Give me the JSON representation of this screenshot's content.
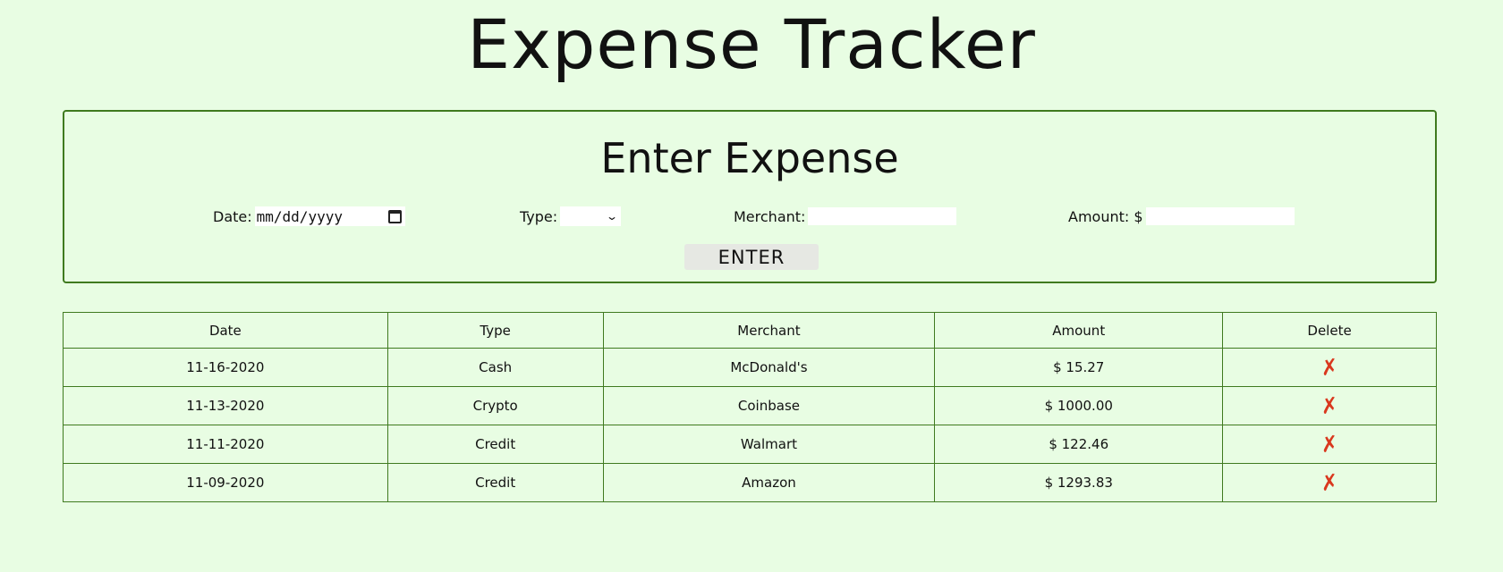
{
  "page": {
    "title": "Expense Tracker"
  },
  "form": {
    "title": "Enter Expense",
    "date_label": "Date:",
    "date_placeholder": "mm/dd/yyyy",
    "type_label": "Type:",
    "type_value": "",
    "merchant_label": "Merchant:",
    "merchant_value": "",
    "amount_label": "Amount: $",
    "amount_value": "",
    "submit_label": "ENTER"
  },
  "table": {
    "headers": [
      "Date",
      "Type",
      "Merchant",
      "Amount",
      "Delete"
    ],
    "rows": [
      {
        "date": "11-16-2020",
        "type": "Cash",
        "merchant": "McDonald's",
        "amount": "$ 15.27"
      },
      {
        "date": "11-13-2020",
        "type": "Crypto",
        "merchant": "Coinbase",
        "amount": "$ 1000.00"
      },
      {
        "date": "11-11-2020",
        "type": "Credit",
        "merchant": "Walmart",
        "amount": "$ 122.46"
      },
      {
        "date": "11-09-2020",
        "type": "Credit",
        "merchant": "Amazon",
        "amount": "$ 1293.83"
      }
    ],
    "delete_icon": "delete-x-icon"
  },
  "colors": {
    "background": "#e8fde3",
    "border": "#3f7a1f",
    "delete": "#d9381e"
  }
}
